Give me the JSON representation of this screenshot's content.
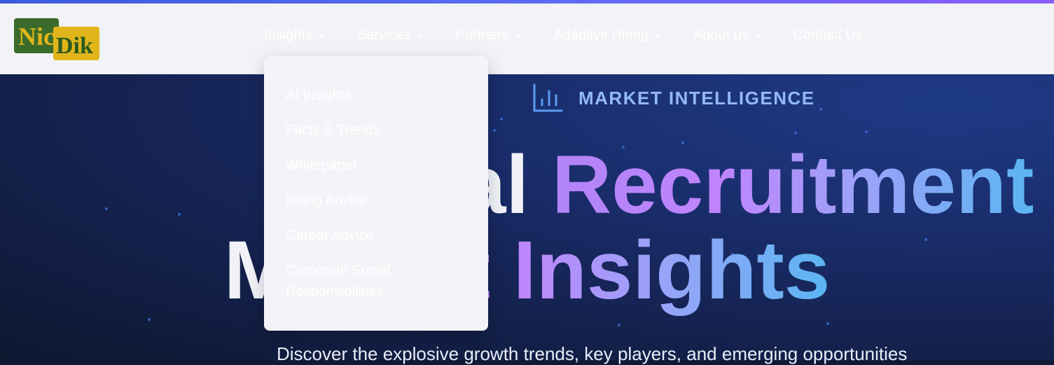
{
  "brand": {
    "logo_text_1": "Nic",
    "logo_text_2": "Dik"
  },
  "nav": {
    "items": [
      {
        "label": "Insights",
        "has_dropdown": true
      },
      {
        "label": "Services",
        "has_dropdown": true
      },
      {
        "label": "Partners",
        "has_dropdown": true
      },
      {
        "label": "Adaptive Hiring",
        "has_dropdown": true
      },
      {
        "label": "About us",
        "has_dropdown": true
      },
      {
        "label": "Contact Us",
        "has_dropdown": false
      }
    ]
  },
  "dropdown": {
    "items": [
      {
        "label": "AI Insights"
      },
      {
        "label": "Facts & Trends"
      },
      {
        "label": "Whitepaper"
      },
      {
        "label": "Hiring Advice"
      },
      {
        "label": "Career Advice"
      },
      {
        "label": "Corporate Social Responsibilities"
      }
    ]
  },
  "hero": {
    "badge": "MARKET INTELLIGENCE",
    "title_plain": "Global",
    "title_grad": "Recruitment",
    "title_line2_plain": "Ma",
    "title_line2_grad": "rket Insights",
    "subtitle": "Discover the explosive growth trends, key players, and emerging opportunities"
  },
  "colors": {
    "accent_gradient_start": "#3b5bdb",
    "accent_gradient_end": "#8b5cf6",
    "navbar_bg": "#f2f3f6",
    "hero_bg": "#1a2d6b",
    "badge_text": "#93b9f7",
    "logo_green": "#3a6b2a",
    "logo_gold": "#e0b51b"
  },
  "icons": {
    "badge": "bar-chart-icon",
    "nav_chevron": "chevron-down-icon"
  }
}
